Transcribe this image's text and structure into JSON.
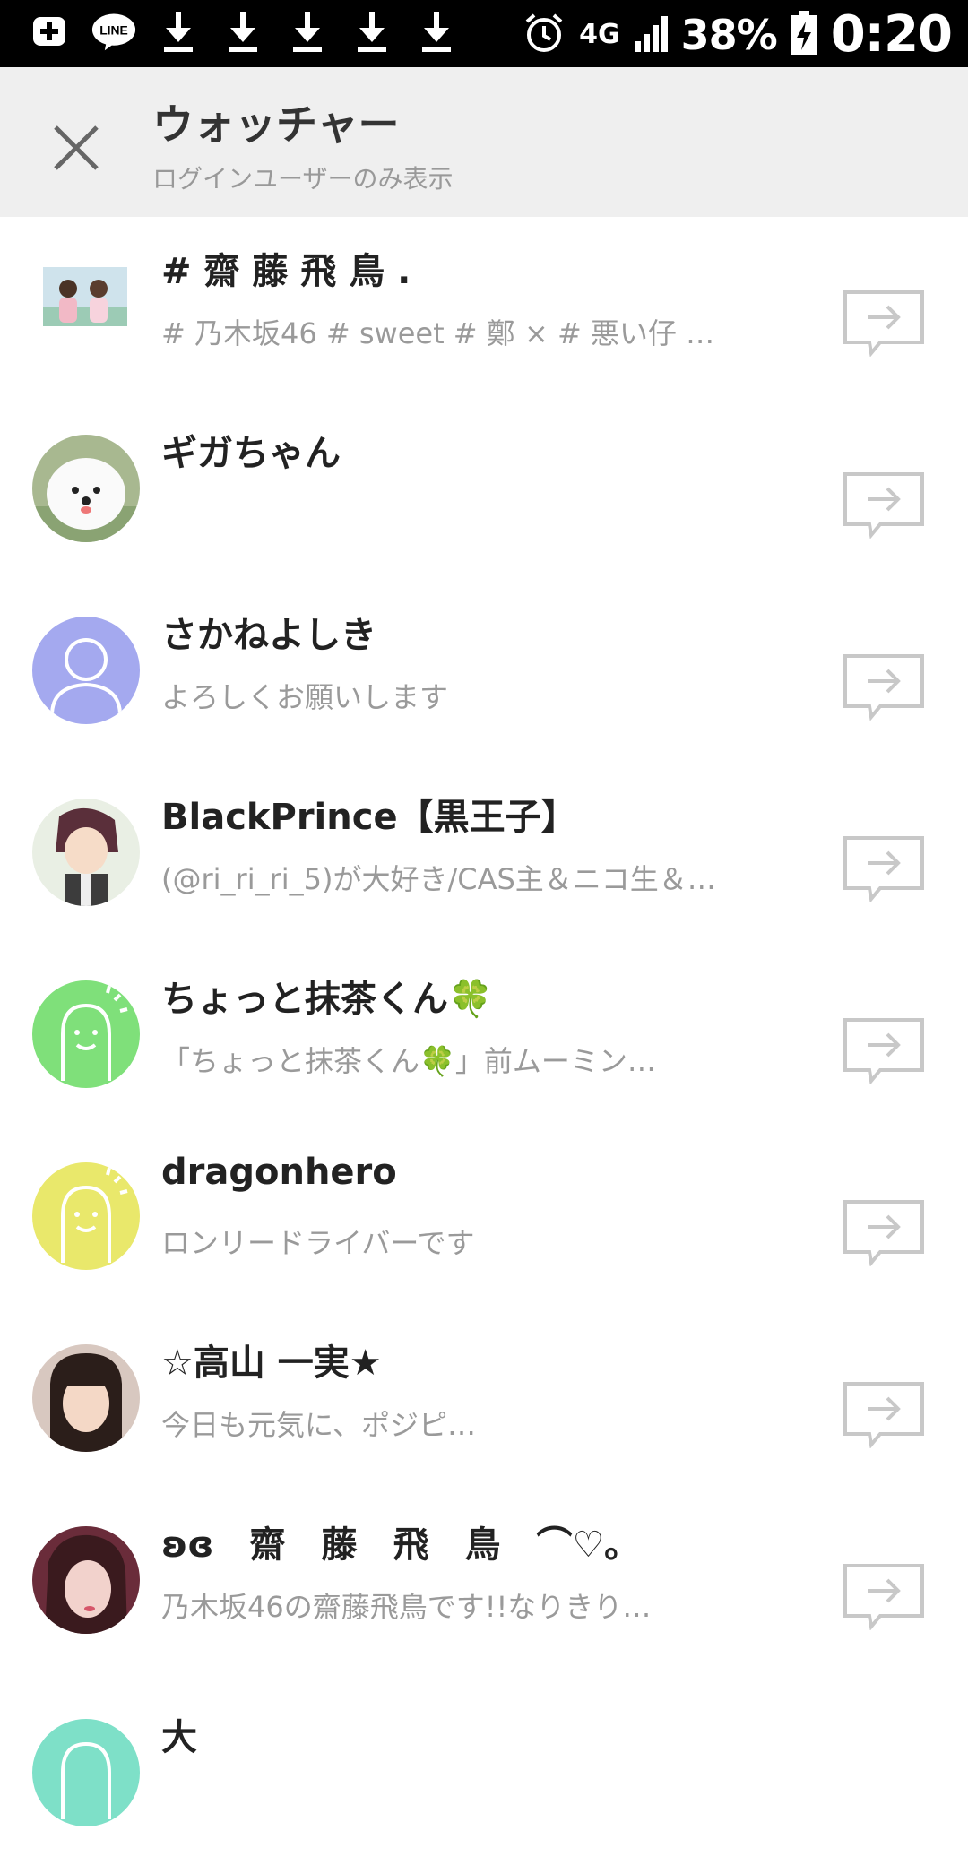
{
  "status_bar": {
    "left_icons": [
      "add-icon",
      "line-app-icon",
      "download-icon",
      "download-icon",
      "download-icon",
      "download-icon",
      "download-icon"
    ],
    "line_label": "LINE",
    "network": "4G",
    "battery": "38%",
    "time": "0:20"
  },
  "header": {
    "title": "ウォッチャー",
    "subtitle": "ログインユーザーのみ表示"
  },
  "users": [
    {
      "name": "# 齋 藤 飛 鳥 .",
      "status": "# 乃木坂46 # sweet # 鄭 × # 悪い仔 …",
      "avatar": "photo-two-girls"
    },
    {
      "name": "ギガちゃん",
      "status": "",
      "avatar": "photo-white-dog"
    },
    {
      "name": "さかねよしき",
      "status": "よろしくお願いします",
      "avatar": "default-person-purple"
    },
    {
      "name": "BlackPrince【黒王子】",
      "status": "(@ri_ri_ri_5)が大好き/CAS主＆ニコ生＆…",
      "avatar": "photo-anime-boy"
    },
    {
      "name": "ちょっと抹茶くん🍀",
      "status": "「ちょっと抹茶くん🍀」前ムーミン…",
      "avatar": "default-face-green"
    },
    {
      "name": "dragonhero",
      "status": "ロンリードライバーです",
      "avatar": "default-face-yellow"
    },
    {
      "name": "☆高山 一実★",
      "status": "今日も元気に、ポジピ…",
      "avatar": "photo-girl-1"
    },
    {
      "name": "ʚɞ　齋　藤　飛　鳥　⌒♡｡",
      "status": "乃木坂46の齋藤飛鳥です!!なりきり…",
      "avatar": "photo-girl-2"
    },
    {
      "name": "大",
      "status": "",
      "avatar": "default-face-teal"
    }
  ],
  "colors": {
    "header_bg": "#efefef",
    "name": "#222222",
    "status": "#9a9a9a",
    "share_icon": "#c8c8c8",
    "purple": "#a4a9ef",
    "green": "#7fe07a",
    "yellow": "#e9e86b",
    "teal": "#7ee0c8"
  }
}
